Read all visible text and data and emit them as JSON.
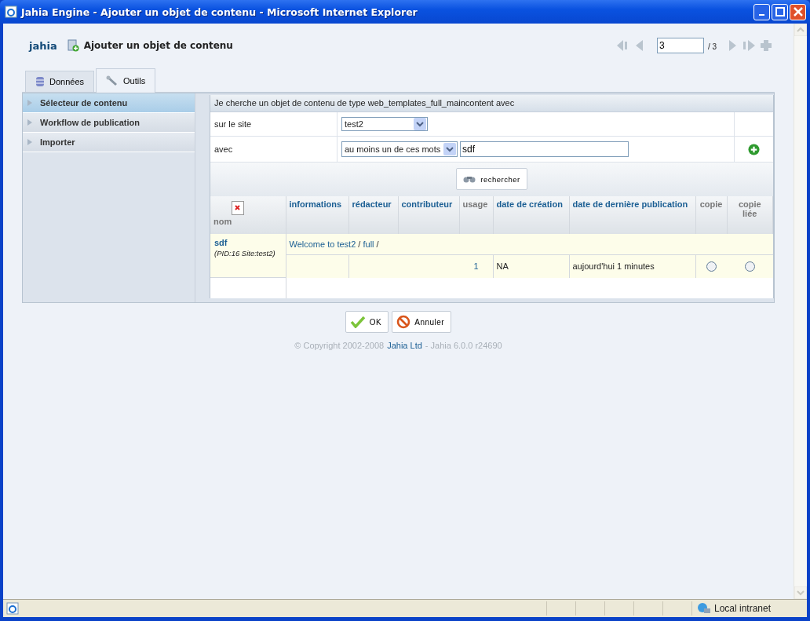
{
  "window": {
    "title": "Jahia Engine - Ajouter un objet de contenu - Microsoft Internet Explorer"
  },
  "header": {
    "logo": "jahia",
    "title": "Ajouter un objet de contenu"
  },
  "pager": {
    "page": "3",
    "total": "/ 3"
  },
  "tabs": [
    {
      "label": "Données",
      "selected": false
    },
    {
      "label": "Outils",
      "selected": true
    }
  ],
  "sidebar": {
    "items": [
      {
        "label": "Sélecteur de contenu",
        "selected": true
      },
      {
        "label": "Workflow de publication",
        "selected": false
      },
      {
        "label": "Importer",
        "selected": false
      }
    ]
  },
  "search": {
    "heading": "Je cherche un objet de contenu de type web_templates_full_maincontent avec",
    "site_label": "sur le site",
    "site_value": "test2",
    "with_label": "avec",
    "mode_value": "au moins un de ces mots",
    "query": "sdf",
    "button": "rechercher"
  },
  "table": {
    "columns": [
      {
        "label": "nom",
        "sortable": false
      },
      {
        "label": "informations",
        "sortable": true
      },
      {
        "label": "rédacteur",
        "sortable": true
      },
      {
        "label": "contributeur",
        "sortable": true
      },
      {
        "label": "usage",
        "sortable": false
      },
      {
        "label": "date de création",
        "sortable": true
      },
      {
        "label": "date de dernière publication",
        "sortable": true
      },
      {
        "label": "copie",
        "sortable": false
      },
      {
        "label": "copie liée",
        "sortable": false
      }
    ],
    "rows": [
      {
        "name": "sdf",
        "meta": "(PID:16 Site:test2)",
        "path": [
          {
            "text": "Welcome to test2",
            "kind": "link"
          },
          {
            "text": "/",
            "kind": "sep"
          },
          {
            "text": "full",
            "kind": "link"
          },
          {
            "text": "/",
            "kind": "sep"
          }
        ],
        "usage": "1",
        "created": "NA",
        "published": "aujourd'hui 1 minutes",
        "copy_selected": false,
        "linked_selected": false
      }
    ]
  },
  "buttons": [
    {
      "label": "OK",
      "kind": "ok"
    },
    {
      "label": "Annuler",
      "kind": "cancel"
    }
  ],
  "footer": {
    "before": "© Copyright 2002-2008",
    "link": "Jahia Ltd",
    "after": "- Jahia 6.0.0 r24690"
  },
  "status_bar": {
    "zone": "Local intranet"
  }
}
